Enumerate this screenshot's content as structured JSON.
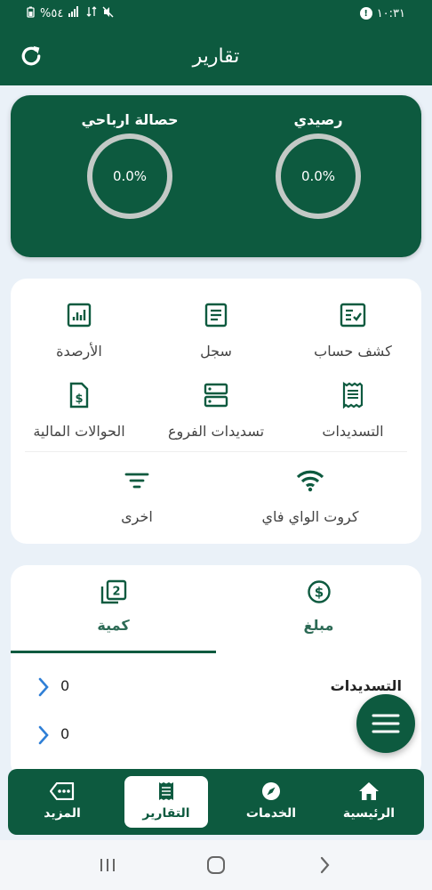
{
  "status_bar": {
    "time": "١٠:٣١",
    "battery": "%٥٤"
  },
  "header": {
    "title": "تقارير"
  },
  "balance_card": {
    "my_balance": {
      "label": "رصيدي",
      "value": "0.0%"
    },
    "profit": {
      "label": "حصالة ارباحي",
      "value": "0.0%"
    }
  },
  "menu": {
    "items": [
      {
        "label": "كشف حساب",
        "icon": "account-statement-icon"
      },
      {
        "label": "سجل",
        "icon": "log-icon"
      },
      {
        "label": "الأرصدة",
        "icon": "balances-icon"
      },
      {
        "label": "التسديدات",
        "icon": "receipt-icon"
      },
      {
        "label": "تسديدات الفروع",
        "icon": "server-icon"
      },
      {
        "label": "الحوالات المالية",
        "icon": "money-document-icon"
      },
      {
        "label": "كروت الواي فاي",
        "icon": "wifi-icon"
      },
      {
        "label": "اخرى",
        "icon": "filter-icon"
      }
    ]
  },
  "stats": {
    "tabs": [
      {
        "label": "مبلغ",
        "icon": "dollar-icon"
      },
      {
        "label": "كمية",
        "icon": "quantity-icon"
      }
    ],
    "rows": [
      {
        "name": "التسديدات",
        "value": "0"
      },
      {
        "name": "",
        "value": "0"
      }
    ]
  },
  "bottom_nav": {
    "items": [
      {
        "label": "الرئيسية",
        "icon": "home-icon"
      },
      {
        "label": "الخدمات",
        "icon": "compass-icon"
      },
      {
        "label": "التقارير",
        "icon": "reports-icon"
      },
      {
        "label": "المزيد",
        "icon": "more-icon"
      }
    ]
  },
  "colors": {
    "primary": "#0d5a3f",
    "background": "#eaf1f8",
    "gauge_ring": "#c3c9c6"
  }
}
